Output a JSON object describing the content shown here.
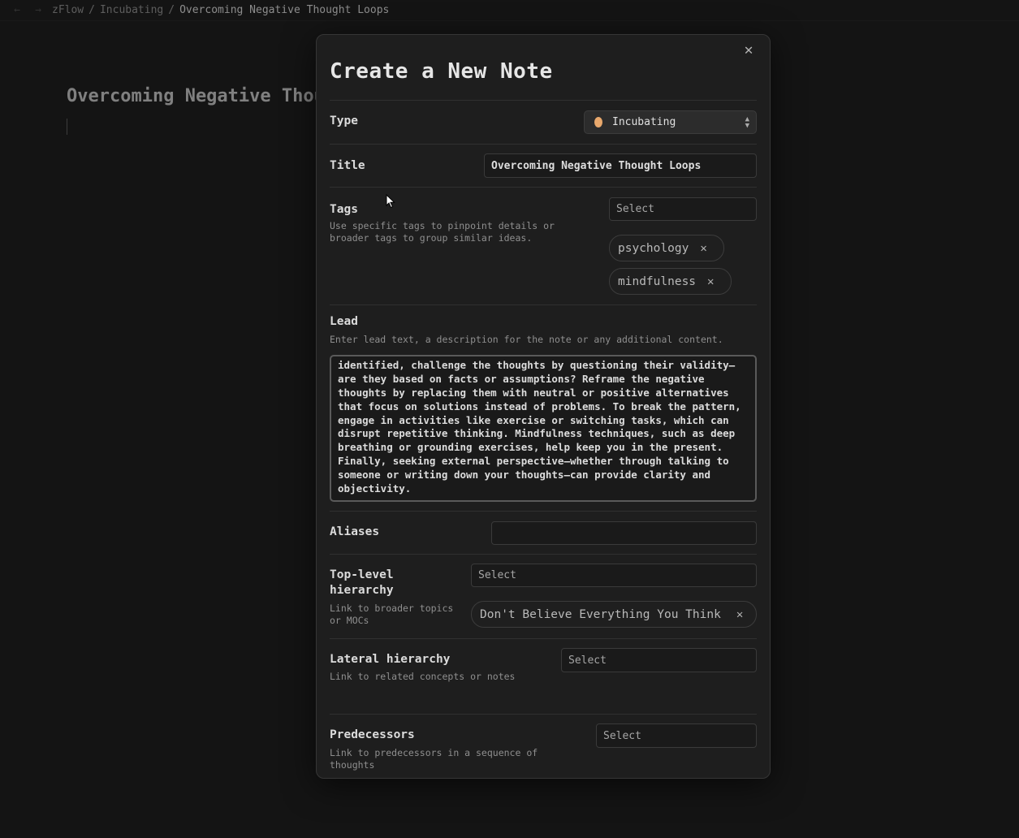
{
  "breadcrumb": {
    "root": "zFlow",
    "folder": "Incubating",
    "current": "Overcoming Negative Thought Loops",
    "separator": "/"
  },
  "nav": {
    "back_glyph": "←",
    "forward_glyph": "→"
  },
  "editor": {
    "title": "Overcoming Negative Thought Loops"
  },
  "modal": {
    "title": "Create a New Note",
    "close_glyph": "✕",
    "type": {
      "label": "Type",
      "value": "Incubating",
      "dot_color": "#e8a86c"
    },
    "title_field": {
      "label": "Title",
      "value": "Overcoming Negative Thought Loops"
    },
    "tags": {
      "label": "Tags",
      "description": "Use specific tags to pinpoint details or broader tags to group similar ideas.",
      "placeholder": "Select",
      "items": [
        "psychology",
        "mindfulness"
      ]
    },
    "lead": {
      "label": "Lead",
      "description": "Enter lead text, a description for the note or any additional content.",
      "text": "identified, challenge the thoughts by questioning their validity—are they based on facts or assumptions? Reframe the negative thoughts by replacing them with neutral or positive alternatives that focus on solutions instead of problems. To break the pattern, engage in activities like exercise or switching tasks, which can disrupt repetitive thinking. Mindfulness techniques, such as deep breathing or grounding exercises, help keep you in the present. Finally, seeking external perspective—whether through talking to someone or writing down your thoughts—can provide clarity and objectivity."
    },
    "aliases": {
      "label": "Aliases",
      "value": ""
    },
    "top_level": {
      "label": "Top-level hierarchy",
      "description": "Link to broader topics or MOCs",
      "placeholder": "Select",
      "items": [
        "Don't Believe Everything You Think"
      ]
    },
    "lateral": {
      "label": "Lateral hierarchy",
      "description": "Link to related concepts or notes",
      "placeholder": "Select"
    },
    "predecessors": {
      "label": "Predecessors",
      "description": "Link to predecessors in a sequence of thoughts",
      "placeholder": "Select"
    },
    "remove_glyph": "✕"
  }
}
